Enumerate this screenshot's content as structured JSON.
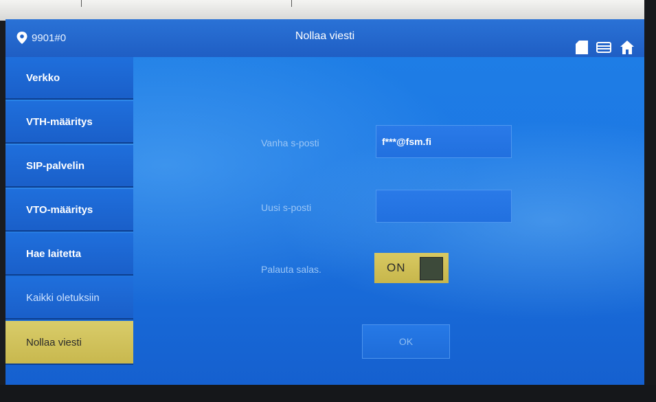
{
  "header": {
    "location": "9901#0",
    "title": "Nollaa viesti"
  },
  "sidebar": {
    "items": [
      {
        "label": "Verkko"
      },
      {
        "label": "VTH-määritys"
      },
      {
        "label": "SIP-palvelin"
      },
      {
        "label": "VTO-määritys"
      },
      {
        "label": "Hae laitetta"
      },
      {
        "label": "Kaikki oletuksiin"
      },
      {
        "label": "Nollaa viesti",
        "active": true
      }
    ]
  },
  "form": {
    "old_email_label": "Vanha s-posti",
    "old_email_value": "f***@fsm.fi",
    "new_email_label": "Uusi s-posti",
    "new_email_value": "",
    "restore_label": "Palauta salas.",
    "restore_toggle": "ON",
    "ok_label": "OK"
  },
  "icons": [
    "location-pin-icon",
    "sd-card-icon",
    "storage-icon",
    "home-icon"
  ],
  "colors": {
    "screen_blue": "#1e7fe6",
    "active_yellow": "#d9cc6a",
    "toggle_knob": "#3d4a3a"
  }
}
